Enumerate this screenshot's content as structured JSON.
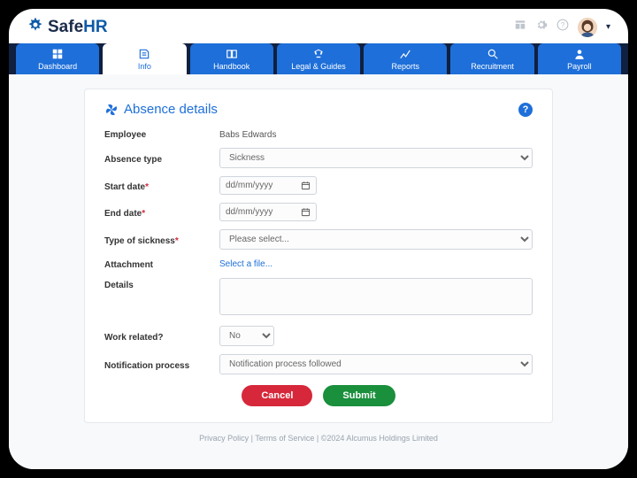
{
  "brand": {
    "safe": "Safe",
    "hr": "HR"
  },
  "nav": {
    "dashboard": "Dashboard",
    "info": "Info",
    "handbook": "Handbook",
    "legal": "Legal & Guides",
    "reports": "Reports",
    "recruitment": "Recruitment",
    "payroll": "Payroll"
  },
  "card": {
    "title": "Absence details",
    "help": "?"
  },
  "form": {
    "employee_lbl": "Employee",
    "employee_val": "Babs Edwards",
    "absence_type_lbl": "Absence type",
    "absence_type_val": "Sickness",
    "start_lbl": "Start date",
    "end_lbl": "End date",
    "date_placeholder": "dd/mm/yyyy",
    "sickness_lbl": "Type of sickness",
    "sickness_placeholder": "Please select...",
    "attachment_lbl": "Attachment",
    "attachment_link": "Select a file...",
    "details_lbl": "Details",
    "work_lbl": "Work related?",
    "work_val": "No",
    "notif_lbl": "Notification process",
    "notif_val": "Notification process followed",
    "req": "*"
  },
  "buttons": {
    "cancel": "Cancel",
    "submit": "Submit"
  },
  "footer": {
    "privacy": "Privacy Policy",
    "terms": "Terms of Service",
    "copy": "©2024 Alcumus Holdings Limited",
    "sep": " | "
  }
}
